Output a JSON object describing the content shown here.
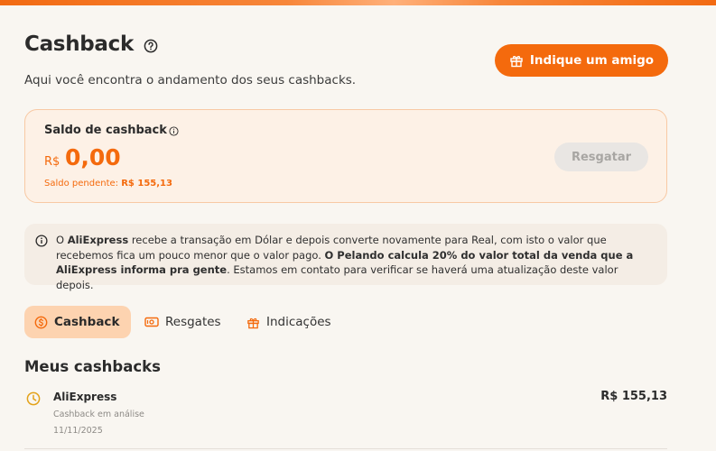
{
  "page": {
    "title": "Cashback",
    "subtitle": "Aqui você encontra o andamento dos seus cashbacks.",
    "invite_label": "Indique um amigo"
  },
  "balance": {
    "label": "Saldo de cashback",
    "currency": "R$",
    "amount": "0,00",
    "pending_label": "Saldo pendente:",
    "pending_value": "R$ 155,13",
    "redeem_label": "Resgatar"
  },
  "notice": {
    "part1": "O ",
    "part2": "AliExpress",
    "part3": " recebe a transação em Dólar e depois converte novamente para Real, com isto o valor que recebemos fica um pouco menor que o valor pago. ",
    "part4": "O Pelando calcula 20% do valor total da venda que a AliExpress informa pra gente",
    "part5": ". Estamos em contato para verificar se haverá uma atualização deste valor depois."
  },
  "tabs": [
    {
      "label": "Cashback",
      "icon": "coin-icon",
      "active": true
    },
    {
      "label": "Resgates",
      "icon": "banknote-icon",
      "active": false
    },
    {
      "label": "Indicações",
      "icon": "gift-icon",
      "active": false
    }
  ],
  "list": {
    "title": "Meus cashbacks",
    "items": [
      {
        "merchant": "AliExpress",
        "amount": "R$ 155,13",
        "status": "Cashback em análise",
        "date": "11/11/2025",
        "icon": "clock-icon"
      }
    ]
  },
  "colors": {
    "accent": "#f46a0d",
    "background": "#f9f6f1",
    "card_bg": "#fdf1e6",
    "active_tab_bg": "#fdd3b0",
    "pending_icon": "#e3a21a"
  }
}
